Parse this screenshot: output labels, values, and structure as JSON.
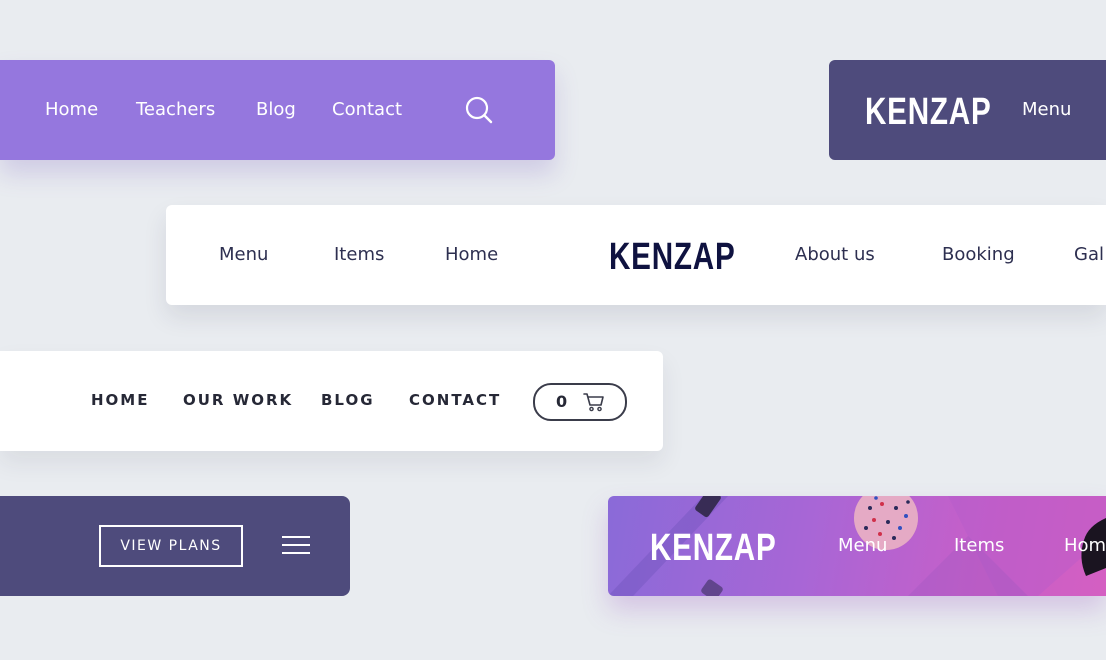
{
  "bar1": {
    "links": [
      "Home",
      "Teachers",
      "Blog",
      "Contact"
    ],
    "search_icon": "search-icon",
    "color": "#9577de"
  },
  "bar2": {
    "logo": "KENZAP",
    "links": [
      "Menu"
    ],
    "color": "#4e4b7c"
  },
  "bar3": {
    "left_links": [
      "Menu",
      "Items",
      "Home"
    ],
    "logo": "KENZAP",
    "right_links": [
      "About us",
      "Booking",
      "Gal"
    ],
    "color": "#ffffff"
  },
  "bar4": {
    "links": [
      "HOME",
      "OUR WORK",
      "BLOG",
      "CONTACT"
    ],
    "cart_count": "0",
    "cart_icon": "cart-icon"
  },
  "bar5": {
    "button_label": "VIEW PLANS",
    "menu_icon": "hamburger-menu-icon",
    "color": "#4e4b7c"
  },
  "bar6": {
    "logo": "KENZAP",
    "links": [
      "Menu",
      "Items",
      "Hom"
    ],
    "gradient_start": "#8a6ad8",
    "gradient_end": "#d45fc2"
  }
}
